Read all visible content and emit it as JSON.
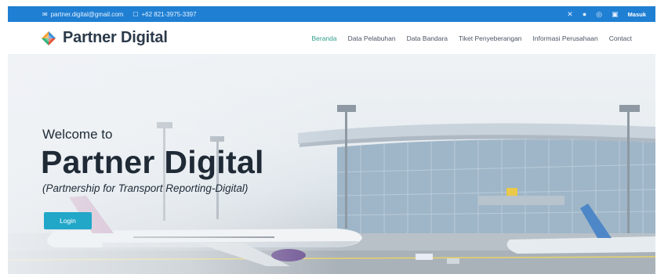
{
  "topbar": {
    "email": "partner.digital@gmail.com",
    "phone": "+62 821-3975-3397",
    "login_label": "Masuk"
  },
  "brand": {
    "name": "Partner Digital"
  },
  "nav": {
    "items": [
      "Beranda",
      "Data Pelabuhan",
      "Data Bandara",
      "Tiket Penyeberangan",
      "Informasi Perusahaan",
      "Contact"
    ],
    "active": "Beranda"
  },
  "hero": {
    "welcome": "Welcome to",
    "title": "Partner Digital",
    "subtitle": "(Partnership for Transport Reporting-Digital)",
    "button_label": "Login"
  },
  "colors": {
    "topbar_bg": "#1f7fd3",
    "nav_active": "#2f9e8a",
    "button_bg": "#22a7c9",
    "heading_text": "#1f2a36"
  },
  "icons": {
    "email": "email-icon",
    "phone": "phone-icon",
    "social": [
      "x-twitter-icon",
      "facebook-icon",
      "instagram-icon",
      "linkedin-icon"
    ],
    "logo": "diamond-logo-icon"
  }
}
